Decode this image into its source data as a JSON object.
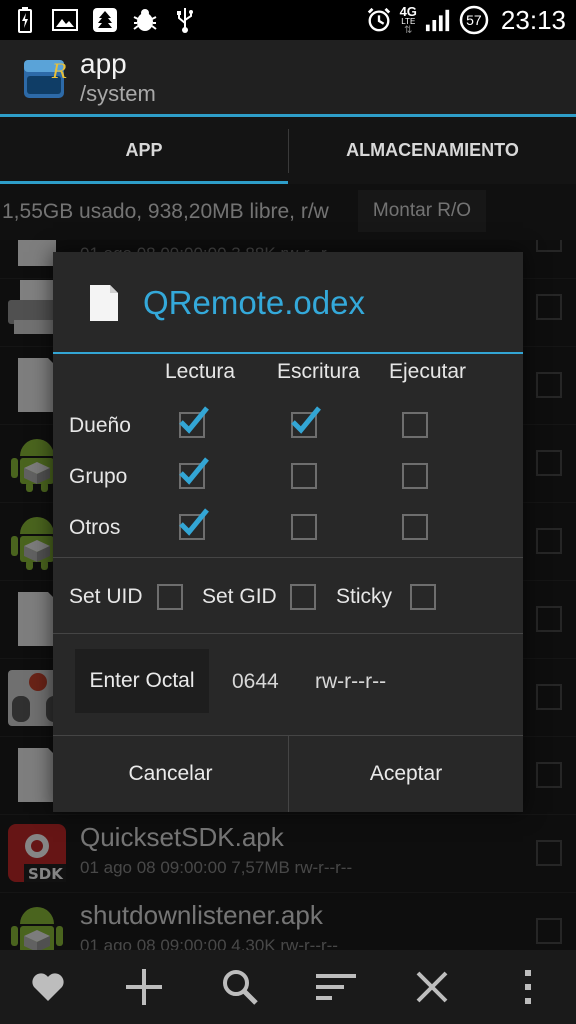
{
  "status_bar": {
    "time": "23:13",
    "network": "4G",
    "network_sub": "LTE",
    "battery": "57",
    "icons": [
      "battery-charging-icon",
      "image-icon",
      "tree-icon",
      "bug-icon",
      "usb-icon",
      "alarm-icon",
      "signal-icon",
      "battery-level-icon"
    ]
  },
  "header": {
    "title": "app",
    "subtitle": "/system"
  },
  "tabs": [
    {
      "label": "APP",
      "selected": true
    },
    {
      "label": "ALMACENAMIENTO",
      "selected": false
    }
  ],
  "storage": {
    "info": "1,55GB usado, 938,20MB libre, r/w",
    "mount_label": "Montar R/O"
  },
  "files": [
    {
      "name": "",
      "meta": "01 ago 08 09:00:00  3,88K  rw-r--r--",
      "icon": "file-icon"
    },
    {
      "name": "",
      "meta": "",
      "icon": "printer-icon"
    },
    {
      "name": "",
      "meta": "",
      "icon": "file-icon"
    },
    {
      "name": "",
      "meta": "",
      "icon": "android-icon"
    },
    {
      "name": "",
      "meta": "",
      "icon": "android-icon"
    },
    {
      "name": "",
      "meta": "",
      "icon": "file-icon"
    },
    {
      "name": "",
      "meta": "",
      "icon": "remote-icon"
    },
    {
      "name": "",
      "meta": "",
      "icon": "file-icon"
    },
    {
      "name": "QuicksetSDK.apk",
      "meta": "01 ago 08 09:00:00  7,57MB  rw-r--r--",
      "icon": "sdk-icon"
    },
    {
      "name": "shutdownlistener.apk",
      "meta": "01 ago 08 09:00:00  4,30K  rw-r--r--",
      "icon": "android-icon"
    }
  ],
  "dialog": {
    "title": "QRemote.odex",
    "columns": [
      "Lectura",
      "Escritura",
      "Ejecutar"
    ],
    "rows": [
      {
        "label": "Dueño",
        "checks": [
          true,
          true,
          false
        ]
      },
      {
        "label": "Grupo",
        "checks": [
          true,
          false,
          false
        ]
      },
      {
        "label": "Otros",
        "checks": [
          true,
          false,
          false
        ]
      }
    ],
    "flags": [
      {
        "label": "Set UID",
        "checked": false
      },
      {
        "label": "Set GID",
        "checked": false
      },
      {
        "label": "Sticky",
        "checked": false
      }
    ],
    "octal_button": "Enter Octal",
    "octal_value": "0644",
    "permission_string": "rw-r--r--",
    "cancel_label": "Cancelar",
    "accept_label": "Aceptar"
  },
  "bottom_bar": {
    "icons": [
      "heart-icon",
      "plus-icon",
      "search-icon",
      "sort-icon",
      "close-icon",
      "overflow-menu-icon"
    ]
  },
  "colors": {
    "accent": "#33a6d5",
    "background": "#1b1b1b",
    "dialog": "#282828"
  }
}
